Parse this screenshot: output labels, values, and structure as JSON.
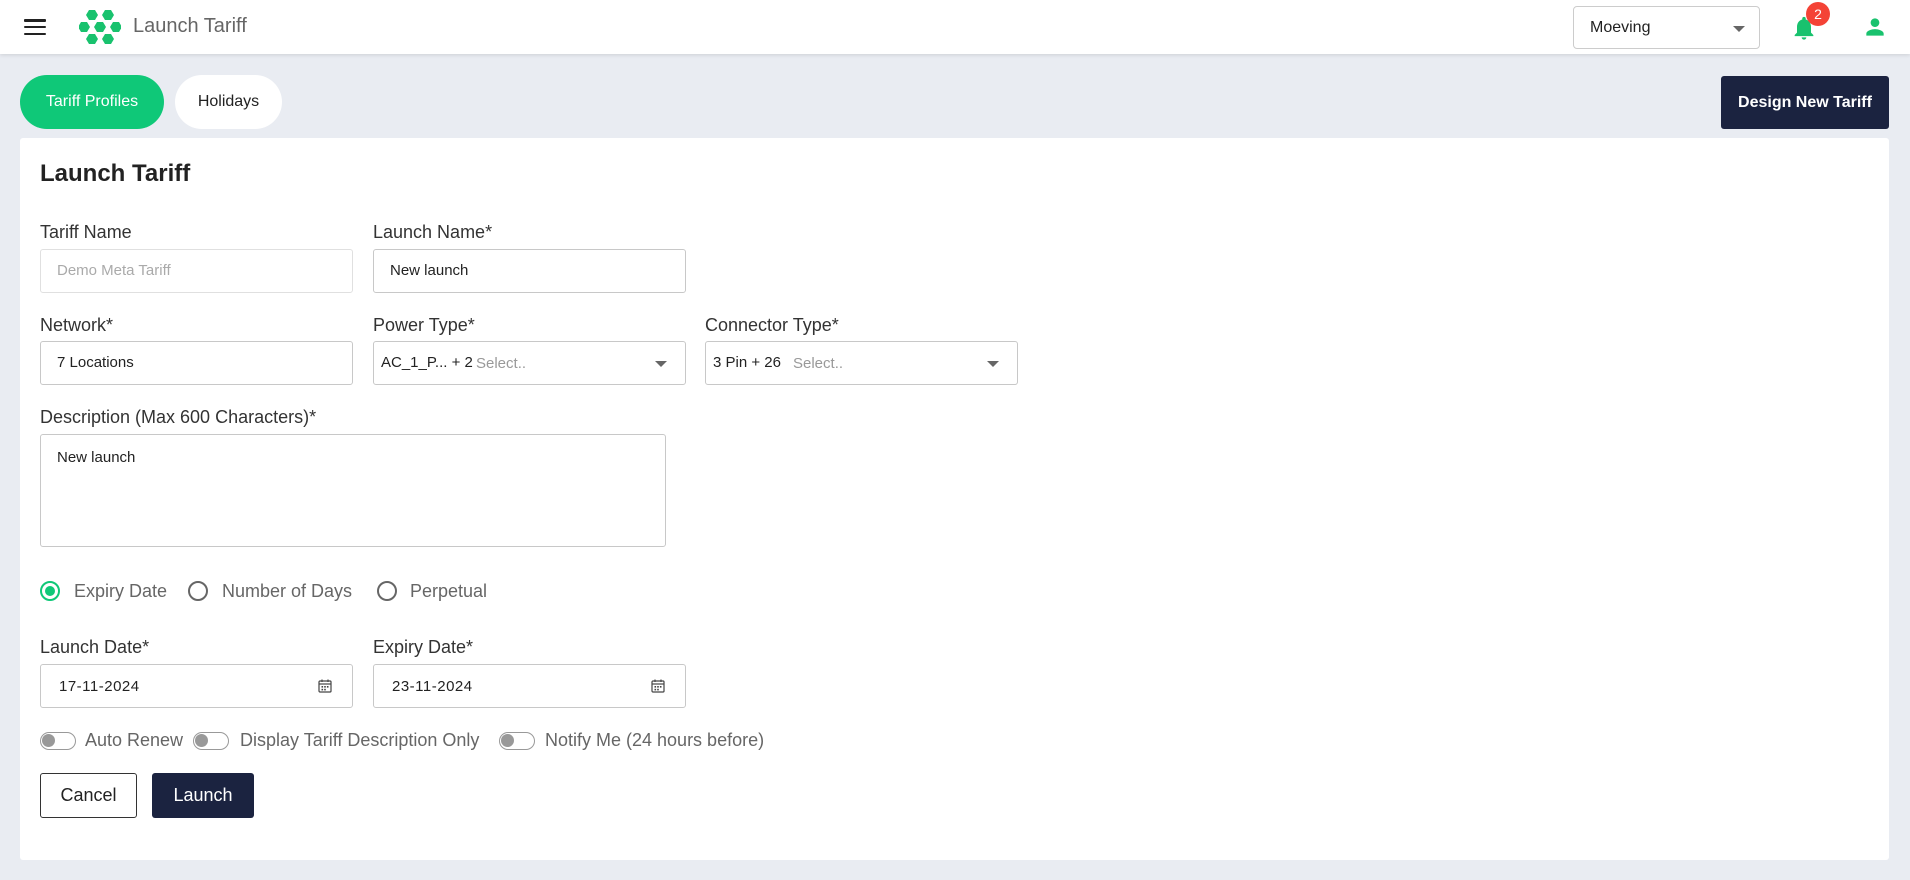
{
  "header": {
    "title": "Launch Tariff",
    "org_select": "Moeving",
    "notifications_count": "2",
    "icons": [
      "menu-icon",
      "hexagon-logo",
      "chevron-down-icon",
      "bell-icon",
      "user-icon"
    ]
  },
  "tabs": [
    {
      "label": "Tariff Profiles",
      "active": true
    },
    {
      "label": "Holidays",
      "active": false
    }
  ],
  "design_button": "Design New Tariff",
  "form": {
    "title": "Launch Tariff",
    "tariff_name": {
      "label": "Tariff Name",
      "placeholder": "Demo Meta Tariff"
    },
    "launch_name": {
      "label": "Launch Name*",
      "value": "New launch"
    },
    "network": {
      "label": "Network*",
      "value": "7 Locations"
    },
    "power_type": {
      "label": "Power Type*",
      "selected": "AC_1_P... + 2",
      "placeholder": "Select.."
    },
    "connector_type": {
      "label": "Connector Type*",
      "selected": "3 Pin + 26",
      "placeholder": "Select.."
    },
    "description": {
      "label": "Description (Max 600 Characters)*",
      "value": "New launch"
    },
    "validity_options": [
      {
        "label": "Expiry Date",
        "selected": true
      },
      {
        "label": "Number of Days",
        "selected": false
      },
      {
        "label": "Perpetual",
        "selected": false
      }
    ],
    "launch_date": {
      "label": "Launch Date*",
      "value": "17-11-2024"
    },
    "expiry_date": {
      "label": "Expiry Date*",
      "value": "23-11-2024"
    },
    "toggles": [
      {
        "label": "Auto Renew",
        "on": false
      },
      {
        "label": "Display Tariff Description Only",
        "on": false
      },
      {
        "label": "Notify Me (24 hours before)",
        "on": false
      }
    ],
    "cancel_label": "Cancel",
    "launch_label": "Launch"
  },
  "colors": {
    "accent": "#0fc878",
    "primary_dark": "#1b2340",
    "badge": "#f44336",
    "background": "#e9ecf2"
  }
}
